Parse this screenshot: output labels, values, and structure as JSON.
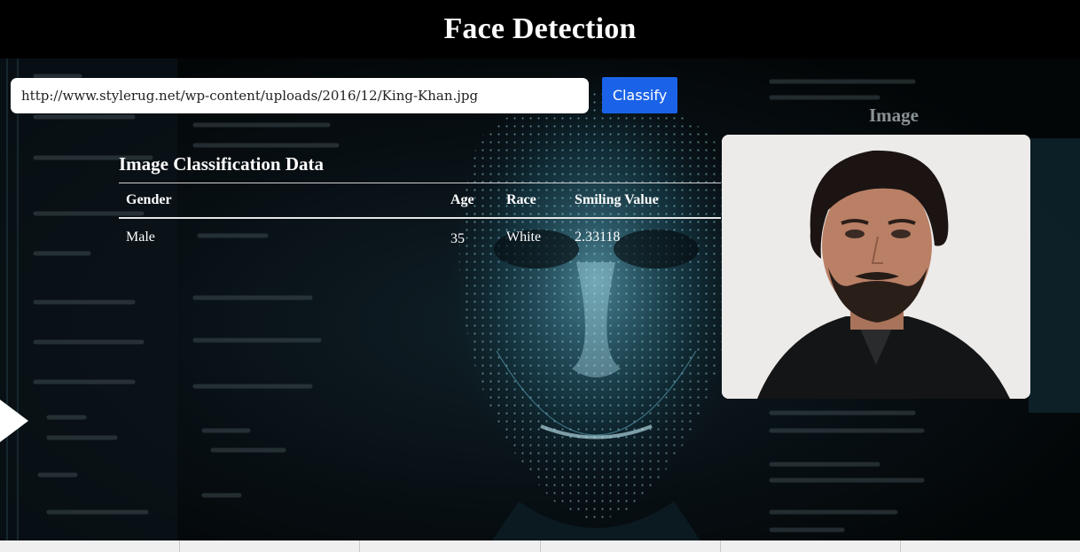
{
  "header": {
    "title": "Face Detection"
  },
  "search": {
    "url_value": "http://www.stylerug.net/wp-content/uploads/2016/12/King-Khan.jpg",
    "classify_label": "Classify"
  },
  "classification": {
    "title": "Image Classification Data",
    "columns": [
      "Gender",
      "Age",
      "Race",
      "Smiling Value"
    ],
    "row": {
      "gender": "Male",
      "age": "35",
      "race": "White",
      "smiling_value": "2.33118"
    }
  },
  "image_panel": {
    "label": "Image"
  },
  "icons": {
    "side_arrow": "play-arrow-icon"
  },
  "colors": {
    "classify_button": "#1a63e8",
    "background": "#000000"
  }
}
